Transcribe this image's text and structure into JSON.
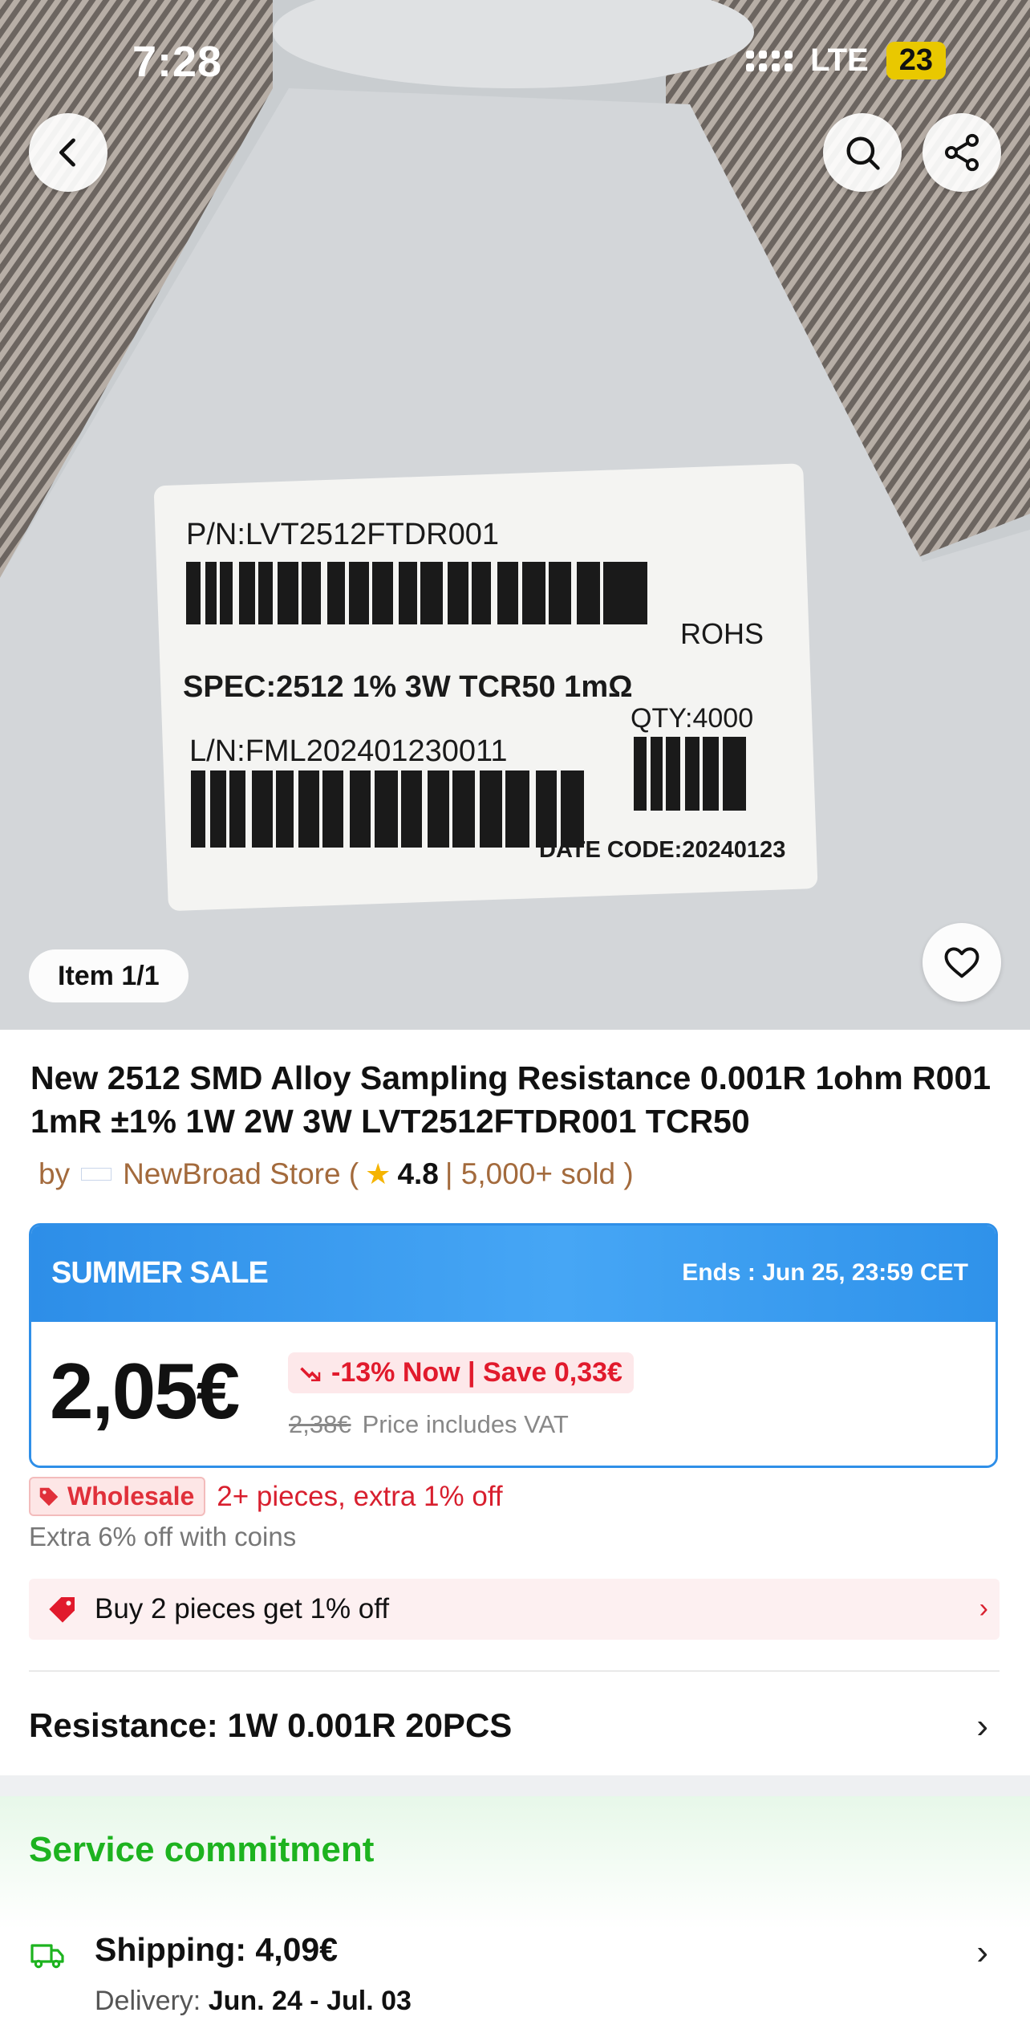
{
  "status_bar": {
    "time": "7:28",
    "network": "LTE",
    "battery": "23"
  },
  "hero": {
    "item_counter": "Item 1/1"
  },
  "hero_label": {
    "pn": "P/N:LVT2512FTDR001",
    "spec": "SPEC:2512 1%  3W TCR50 1mΩ",
    "rohs": "ROHS",
    "ln": "L/N:FML202401230011",
    "qty": "QTY:4000",
    "date_code": "DATE CODE:20240123"
  },
  "product": {
    "title": "New 2512 SMD Alloy Sampling Resistance 0.001R 1ohm R001 1mR ±1% 1W 2W 3W LVT2512FTDR001 TCR50",
    "by": "by",
    "store_name": "NewBroad Store (",
    "rating": "4.8",
    "sold": "| 5,000+ sold )"
  },
  "sale": {
    "name": "SUMMER SALE",
    "ends": "Ends : Jun 25, 23:59 CET",
    "price": "2,05€",
    "discount": "-13% Now | Save 0,33€",
    "old_price": "2,38€",
    "vat_note": "Price includes VAT"
  },
  "wholesale": {
    "tag": "Wholesale",
    "text": "2+ pieces, extra 1% off"
  },
  "coins_note": "Extra 6% off with coins",
  "promo": {
    "text": "Buy 2 pieces get 1% off"
  },
  "variant": {
    "label": "Resistance: 1W 0.001R 20PCS"
  },
  "service": {
    "heading": "Service commitment",
    "shipping": "Shipping: 4,09€",
    "delivery_label": "Delivery:",
    "delivery_dates": "Jun. 24 - Jul. 03"
  },
  "colors": {
    "accent_red": "#e11a2c",
    "sale_blue": "#2f8fe8",
    "service_green": "#1db31f"
  }
}
